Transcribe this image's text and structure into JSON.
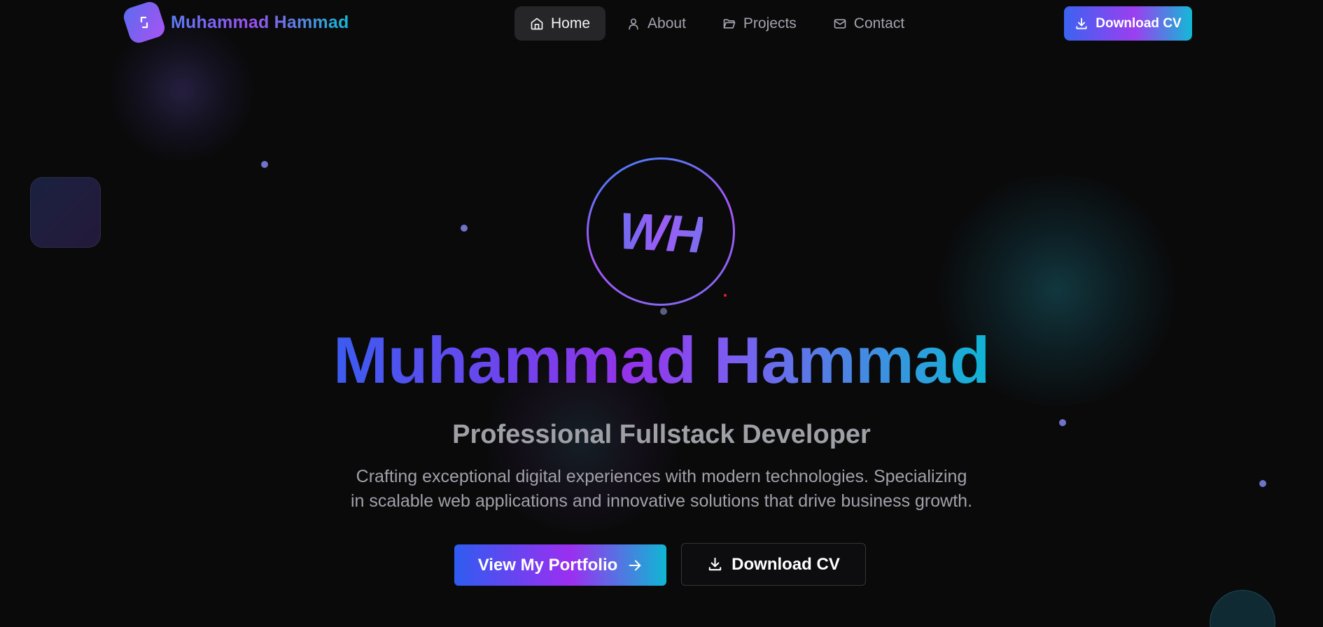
{
  "brand": {
    "name": "Muhammad Hammad",
    "logo_icon": "code-rotate-icon"
  },
  "nav": {
    "items": [
      {
        "label": "Home",
        "icon": "home-icon",
        "active": true
      },
      {
        "label": "About",
        "icon": "user-icon",
        "active": false
      },
      {
        "label": "Projects",
        "icon": "folder-icon",
        "active": false
      },
      {
        "label": "Contact",
        "icon": "mail-icon",
        "active": false
      }
    ],
    "cv_button": {
      "label": "Download CV",
      "icon": "download-icon"
    }
  },
  "hero": {
    "initials": "WH",
    "name": "Muhammad Hammad",
    "title": "Professional Fullstack Developer",
    "description_line1": "Crafting exceptional digital experiences with modern technologies. Specializing",
    "description_line2": "in scalable web applications and innovative solutions that drive business growth.",
    "primary_button": {
      "label": "View My Portfolio",
      "icon": "arrow-right-icon"
    },
    "secondary_button": {
      "label": "Download CV",
      "icon": "download-icon"
    }
  },
  "colors": {
    "background": "#0a0a0b",
    "accent_blue": "#3b5cf0",
    "accent_purple": "#9333ea",
    "accent_cyan": "#0fb5d6",
    "muted_text": "#a1a1aa"
  }
}
